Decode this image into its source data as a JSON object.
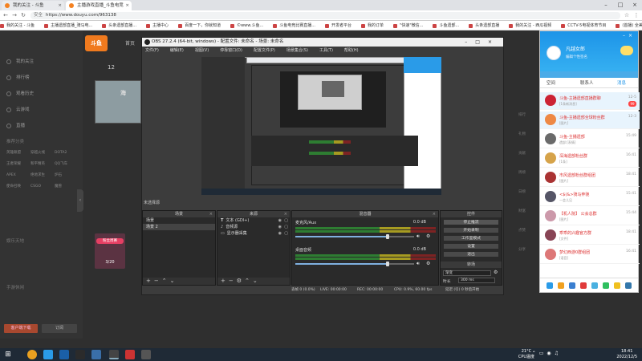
{
  "browser": {
    "tabs": [
      {
        "label": "我的关注 - 斗鱼"
      },
      {
        "label": "主播游戏直播_斗鱼电竞"
      },
      {
        "label": ""
      }
    ],
    "security": "安全",
    "url": "https://www.douyu.com/963138",
    "bookmarks": [
      "我的关注 - 斗鱼",
      "主播遗部直播_骑马电...",
      "头条遗部直播...",
      "主播中心",
      "百度一下，你就知道",
      "©www.斗鱼...",
      "斗鱼电竞比赛直播...",
      "开发者平台",
      "我的订单",
      "\"快速\"微信...",
      "斗鱼遗部...",
      "头条遗部直播",
      "我的关注 - 西瓜视频",
      "CCTV-5电视体育节目",
      "(首播) 全美典藏"
    ]
  },
  "douyu": {
    "logo": "斗鱼",
    "topnav": "首页",
    "count": "12",
    "stream_title": "海",
    "sidebar_items": [
      "我的关注",
      "排行榜",
      "观看历史",
      "云游戏",
      "直播"
    ],
    "sidebar_grid": [
      "英雄联盟",
      "穿越火线",
      "DOTA2",
      "王者荣耀",
      "和平精英",
      "QQ飞车",
      "APEX",
      "绝地求生",
      "炉石",
      "使命召唤",
      "CSGO",
      "魔兽"
    ],
    "sidebar_section2": [
      "推荐分类",
      "娱乐天地",
      "手游休闲"
    ],
    "pk_badge": "粉丝周赛",
    "pk_count": "3/20",
    "btn_primary": "客户端下载",
    "btn_secondary": "订阅",
    "right_items": [
      "排行",
      "礼物",
      "贡献",
      "周榜",
      "日榜",
      "财富",
      "点赞",
      "分享"
    ]
  },
  "obs": {
    "title": "OBS 27.2.4 (64-bit, windows) - 配置文件: 未命名 - 场景: 未命名",
    "menu": [
      "文件(F)",
      "编辑(E)",
      "视图(V)",
      "停靠窗口(D)",
      "配置文件(P)",
      "场景集合(S)",
      "工具(T)",
      "帮助(H)"
    ],
    "no_source": "未选择源",
    "scenes_header": "场景",
    "scenes": [
      "场景",
      "场景 2"
    ],
    "sources_header": "来源",
    "sources": [
      "文本 (GDI+)",
      "音频源",
      "显示器采集"
    ],
    "mixer_header": "混音器",
    "mixer": [
      {
        "name": "麦克风/Aux",
        "db": "0.0 dB",
        "level": 0.78
      },
      {
        "name": "桌面音频",
        "db": "0.0 dB",
        "level": 0.78
      }
    ],
    "controls_header": "控件",
    "controls": [
      "停止推流",
      "开始录制",
      "工作室模式",
      "设置",
      "退出"
    ],
    "transitions_header": "转场",
    "transition_name": "渐变",
    "duration_label": "时长",
    "duration_value": "300 ms",
    "status": {
      "drop": "丢帧 0 (0.0%)",
      "live": "LIVE: 00:00:00",
      "rec": "REC: 00:00:00",
      "cpu": "CPU: 0.9%, 60.00 fps",
      "kbps": "延迟 (引) 0 秒后开始"
    }
  },
  "qq": {
    "name": "凡越女郎",
    "sign": "编辑个性签名",
    "tabs": [
      "空间",
      "联系人",
      "消息"
    ],
    "chats": [
      {
        "name": "斗鱼-主播遗部直播群聊",
        "msg": "[1条新消息]",
        "time": "12-5",
        "count": "99"
      },
      {
        "name": "斗鱼-主播遗部全球粉丝群",
        "msg": "[图片]",
        "time": "12-3",
        "count": ""
      },
      {
        "name": "斗鱼-主播遗部",
        "msg": "遗部:[表情]",
        "time": "15:49",
        "count": ""
      },
      {
        "name": "深海遗部粉丝群",
        "msg": "[1条]",
        "time": "16:41",
        "count": ""
      },
      {
        "name": "市风遗部粉丝群组团",
        "msg": "[图片]",
        "time": "18:41",
        "count": ""
      },
      {
        "name": "<$(&>骑马奔驰",
        "msg": "一会儿见",
        "time": "15:41",
        "count": ""
      },
      {
        "name": "【机人院】 公会总群",
        "msg": "[图片]",
        "time": "15:44",
        "count": ""
      },
      {
        "name": "乖乖的兴趣官方群",
        "msg": "[文件]",
        "time": "18:41",
        "count": ""
      },
      {
        "name": "梦幻西游0群组团",
        "msg": "[语音]",
        "time": "16:41",
        "count": ""
      }
    ]
  },
  "taskbar": {
    "temp": "21°C",
    "temp_label": "CPU温度",
    "time": "18:41",
    "date": "2022/12/5"
  }
}
